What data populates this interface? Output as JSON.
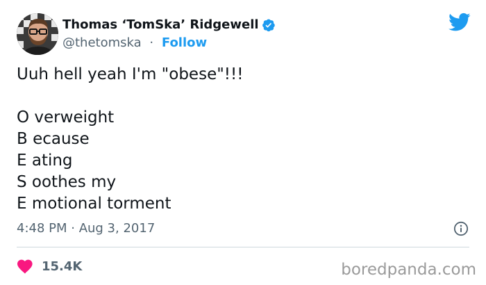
{
  "author": {
    "display_name": "Thomas ‘TomSka’ Ridgewell",
    "handle": "@thetomska",
    "separator": "·",
    "follow_label": "Follow",
    "verified": true
  },
  "tweet": {
    "intro": "Uuh hell yeah I'm \"obese\"!!!",
    "lines": [
      "O verweight",
      "B ecause",
      "E ating",
      "S oothes my",
      "E motional torment"
    ]
  },
  "meta": {
    "timestamp": "4:48 PM · Aug 3, 2017"
  },
  "engagement": {
    "likes": "15.4K"
  },
  "watermark": "boredpanda.com",
  "icons": {
    "brand": "twitter-bird-icon",
    "verified": "verified-badge-icon",
    "info": "info-icon",
    "like": "heart-icon"
  },
  "colors": {
    "brand_blue": "#1d9bf0",
    "heart": "#f91880",
    "muted": "#536471",
    "text": "#0f1419"
  }
}
